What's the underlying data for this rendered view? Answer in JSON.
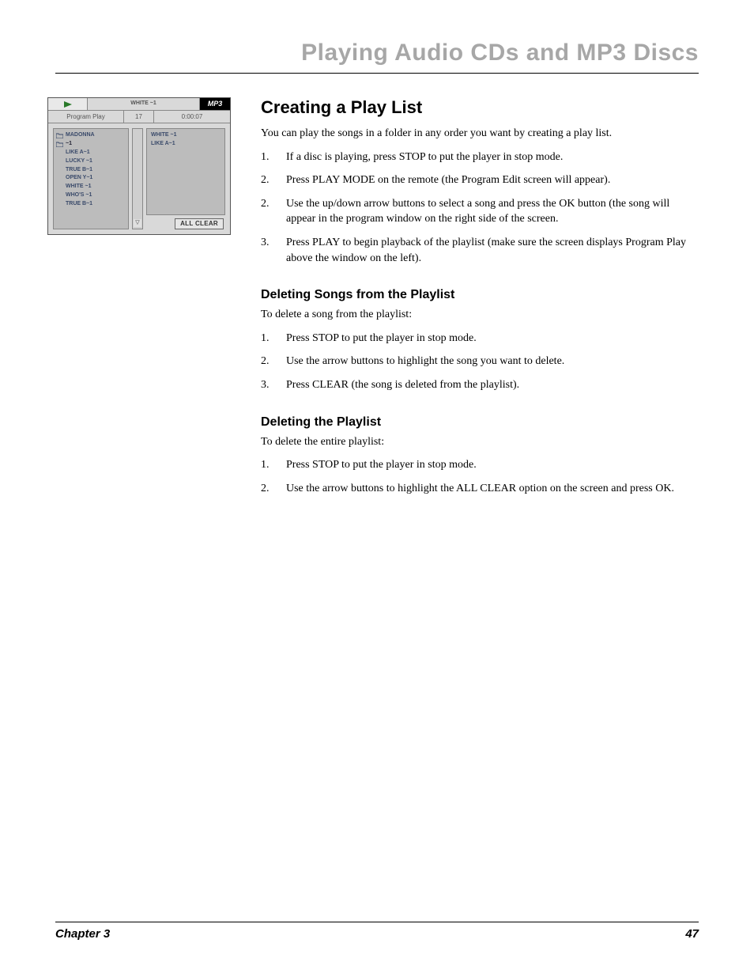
{
  "page": {
    "title": "Playing Audio CDs and MP3 Discs",
    "chapter_label": "Chapter 3",
    "page_number": "47"
  },
  "player": {
    "top_center": "WHITE ~1",
    "mp3_badge": "MP3",
    "row2_left": "Program Play",
    "row2_mid": "17",
    "row2_right": "0:00:07",
    "filelist": [
      {
        "icon": "folder",
        "label": "MADONNA"
      },
      {
        "icon": "folder",
        "label": "~1"
      },
      {
        "icon": "",
        "label": "LIKE A~1"
      },
      {
        "icon": "",
        "label": "LUCKY ~1"
      },
      {
        "icon": "",
        "label": "TRUE B~1"
      },
      {
        "icon": "",
        "label": "OPEN Y~1"
      },
      {
        "icon": "",
        "label": "WHITE ~1"
      },
      {
        "icon": "",
        "label": "WHO'S ~1"
      },
      {
        "icon": "",
        "label": "TRUE B~1"
      }
    ],
    "proglist": [
      "WHITE ~1",
      "LIKE A~1"
    ],
    "all_clear": "ALL CLEAR"
  },
  "sections": {
    "creating": {
      "heading": "Creating a Play List",
      "intro": "You can play the songs in a folder in any order you want by creating a play list.",
      "steps": [
        {
          "n": "1.",
          "t": "If a disc is playing, press STOP to put the player in stop mode."
        },
        {
          "n": "2.",
          "t": "Press PLAY MODE on the remote (the Program Edit screen will appear)."
        },
        {
          "n": "2.",
          "t": "Use the up/down arrow buttons to select a song and press the OK button (the song will appear in the program window on the right side of the screen."
        },
        {
          "n": "3.",
          "t": "Press PLAY to begin playback of the playlist (make sure the screen displays Program Play above the window on the left)."
        }
      ]
    },
    "deleting_songs": {
      "heading": "Deleting Songs from the Playlist",
      "intro": "To delete a song from the playlist:",
      "steps": [
        {
          "n": "1.",
          "t": "Press STOP to put the player in stop mode."
        },
        {
          "n": "2.",
          "t": "Use the arrow buttons to highlight the song you want to delete."
        },
        {
          "n": "3.",
          "t": "Press CLEAR (the song is deleted from the playlist)."
        }
      ]
    },
    "deleting_playlist": {
      "heading": "Deleting the Playlist",
      "intro": "To delete the entire playlist:",
      "steps": [
        {
          "n": "1.",
          "t": "Press STOP to put the player in stop mode."
        },
        {
          "n": "2.",
          "t": "Use the arrow buttons to highlight the ALL CLEAR option on the screen and press OK."
        }
      ]
    }
  }
}
